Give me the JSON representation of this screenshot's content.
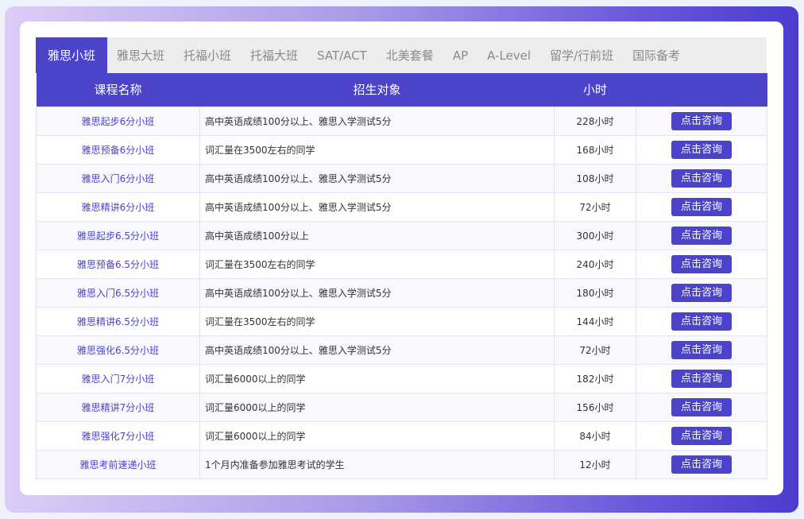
{
  "tabs": [
    "雅思小班",
    "雅思大班",
    "托福小班",
    "托福大班",
    "SAT/ACT",
    "北美套餐",
    "AP",
    "A-Level",
    "留学/行前班",
    "国际备考"
  ],
  "active_tab": 0,
  "columns": [
    "课程名称",
    "招生对象",
    "小时",
    ""
  ],
  "button_label": "点击咨询",
  "rows": [
    {
      "name": "雅思起步6分小班",
      "target": "高中英语成绩100分以上、雅思入学测试5分",
      "hours": "228小时"
    },
    {
      "name": "雅思预备6分小班",
      "target": "词汇量在3500左右的同学",
      "hours": "168小时"
    },
    {
      "name": "雅思入门6分小班",
      "target": "高中英语成绩100分以上、雅思入学测试5分",
      "hours": "108小时"
    },
    {
      "name": "雅思精讲6分小班",
      "target": "高中英语成绩100分以上、雅思入学测试5分",
      "hours": "72小时"
    },
    {
      "name": "雅思起步6.5分小班",
      "target": "高中英语成绩100分以上",
      "hours": "300小时"
    },
    {
      "name": "雅思预备6.5分小班",
      "target": "词汇量在3500左右的同学",
      "hours": "240小时"
    },
    {
      "name": "雅思入门6.5分小班",
      "target": "高中英语成绩100分以上、雅思入学测试5分",
      "hours": "180小时"
    },
    {
      "name": "雅思精讲6.5分小班",
      "target": "词汇量在3500左右的同学",
      "hours": "144小时"
    },
    {
      "name": "雅思强化6.5分小班",
      "target": "高中英语成绩100分以上、雅思入学测试5分",
      "hours": "72小时"
    },
    {
      "name": "雅思入门7分小班",
      "target": "词汇量6000以上的同学",
      "hours": "182小时"
    },
    {
      "name": "雅思精讲7分小班",
      "target": "词汇量6000以上的同学",
      "hours": "156小时"
    },
    {
      "name": "雅思强化7分小班",
      "target": "词汇量6000以上的同学",
      "hours": "84小时"
    },
    {
      "name": "雅思考前速递小班",
      "target": "1个月内准备参加雅思考试的学生",
      "hours": "12小时"
    }
  ],
  "colors": {
    "accent": "#4b43c9",
    "tab_bg": "#ededed"
  }
}
